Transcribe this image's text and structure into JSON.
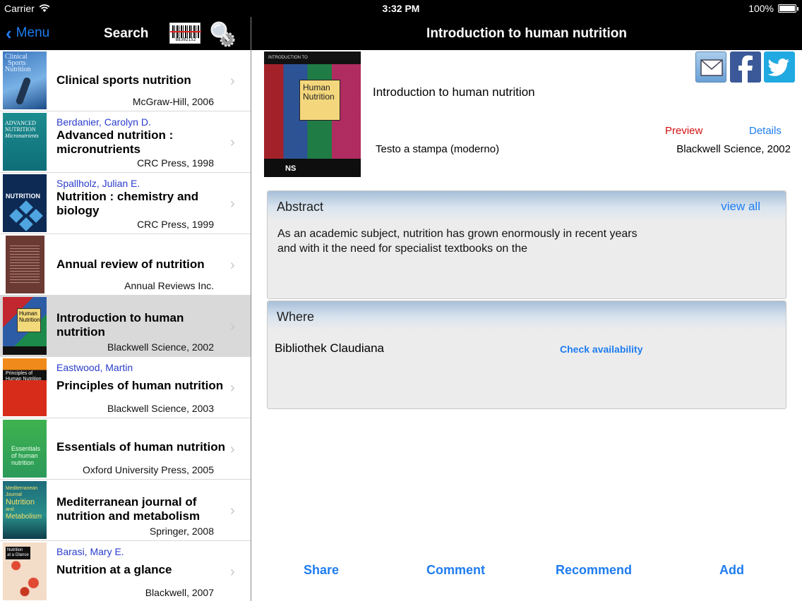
{
  "status": {
    "carrier": "Carrier",
    "time": "3:32 PM",
    "battery": "100%"
  },
  "left_nav": {
    "back_label": "Menu",
    "title": "Search",
    "barcode_number": "88302152"
  },
  "right_nav": {
    "title": "Introduction to human nutrition"
  },
  "list": [
    {
      "author": "",
      "title": "Clinical sports nutrition",
      "publisher": "McGraw-Hill, 2006"
    },
    {
      "author": "Berdanier, Carolyn D.",
      "title": "Advanced nutrition : micronutrients",
      "publisher": "CRC Press, 1998"
    },
    {
      "author": "Spallholz, Julian E.",
      "title": "Nutrition : chemistry and biology",
      "publisher": "CRC Press, 1999"
    },
    {
      "author": "",
      "title": "Annual review of nutrition",
      "publisher": "Annual Reviews Inc."
    },
    {
      "author": "",
      "title": "Introduction to human nutrition",
      "publisher": "Blackwell Science, 2002",
      "selected": true
    },
    {
      "author": "Eastwood, Martin",
      "title": "Principles of human nutrition",
      "publisher": "Blackwell Science, 2003"
    },
    {
      "author": "",
      "title": "Essentials of human nutrition",
      "publisher": "Oxford University Press, 2005"
    },
    {
      "author": "",
      "title": "Mediterranean journal of nutrition and metabolism",
      "publisher": "Springer, 2008"
    },
    {
      "author": "Barasi, Mary E.",
      "title": "Nutrition at a glance",
      "publisher": "Blackwell, 2007"
    }
  ],
  "thumbs": {
    "t0": [
      "Clinical",
      "Sports",
      "Nutrition"
    ],
    "t1": [
      "ADVANCED",
      "NUTRITION",
      "Micronutrients"
    ],
    "t2": "NUTRITION",
    "t4": [
      "Human",
      "Nutrition"
    ],
    "t5": [
      "Principles of",
      "Human Nutrition"
    ],
    "t6": [
      "Essentials",
      "of human",
      "nutrition"
    ],
    "t7": [
      "Mediterranean",
      "Journal",
      "Nutrition",
      "and",
      "Metabolism"
    ],
    "t8": [
      "Nutrition",
      "at a Glance"
    ]
  },
  "detail": {
    "title": "Introduction to human nutrition",
    "preview": "Preview",
    "details": "Details",
    "format": "Testo a stampa (moderno)",
    "publisher": "Blackwell Science, 2002",
    "cover": {
      "series": "INTRODUCTION TO",
      "title_line1": "Human",
      "title_line2": "Nutrition",
      "publisher_mark": "NS"
    },
    "share_icons": [
      "mail-icon",
      "facebook-icon",
      "twitter-icon"
    ]
  },
  "abstract": {
    "heading": "Abstract",
    "view_all": "view all",
    "text": "As an academic subject, nutrition has grown enormously in recent years and with it the need for specialist textbooks on the"
  },
  "where": {
    "heading": "Where",
    "library": "Bibliothek Claudiana",
    "check": "Check availability"
  },
  "toolbar": {
    "share": "Share",
    "comment": "Comment",
    "recommend": "Recommend",
    "add": "Add"
  },
  "colors": {
    "accent": "#1e7cf0",
    "preview": "#d01010",
    "author": "#2a3ccc",
    "nav": "#000000"
  }
}
